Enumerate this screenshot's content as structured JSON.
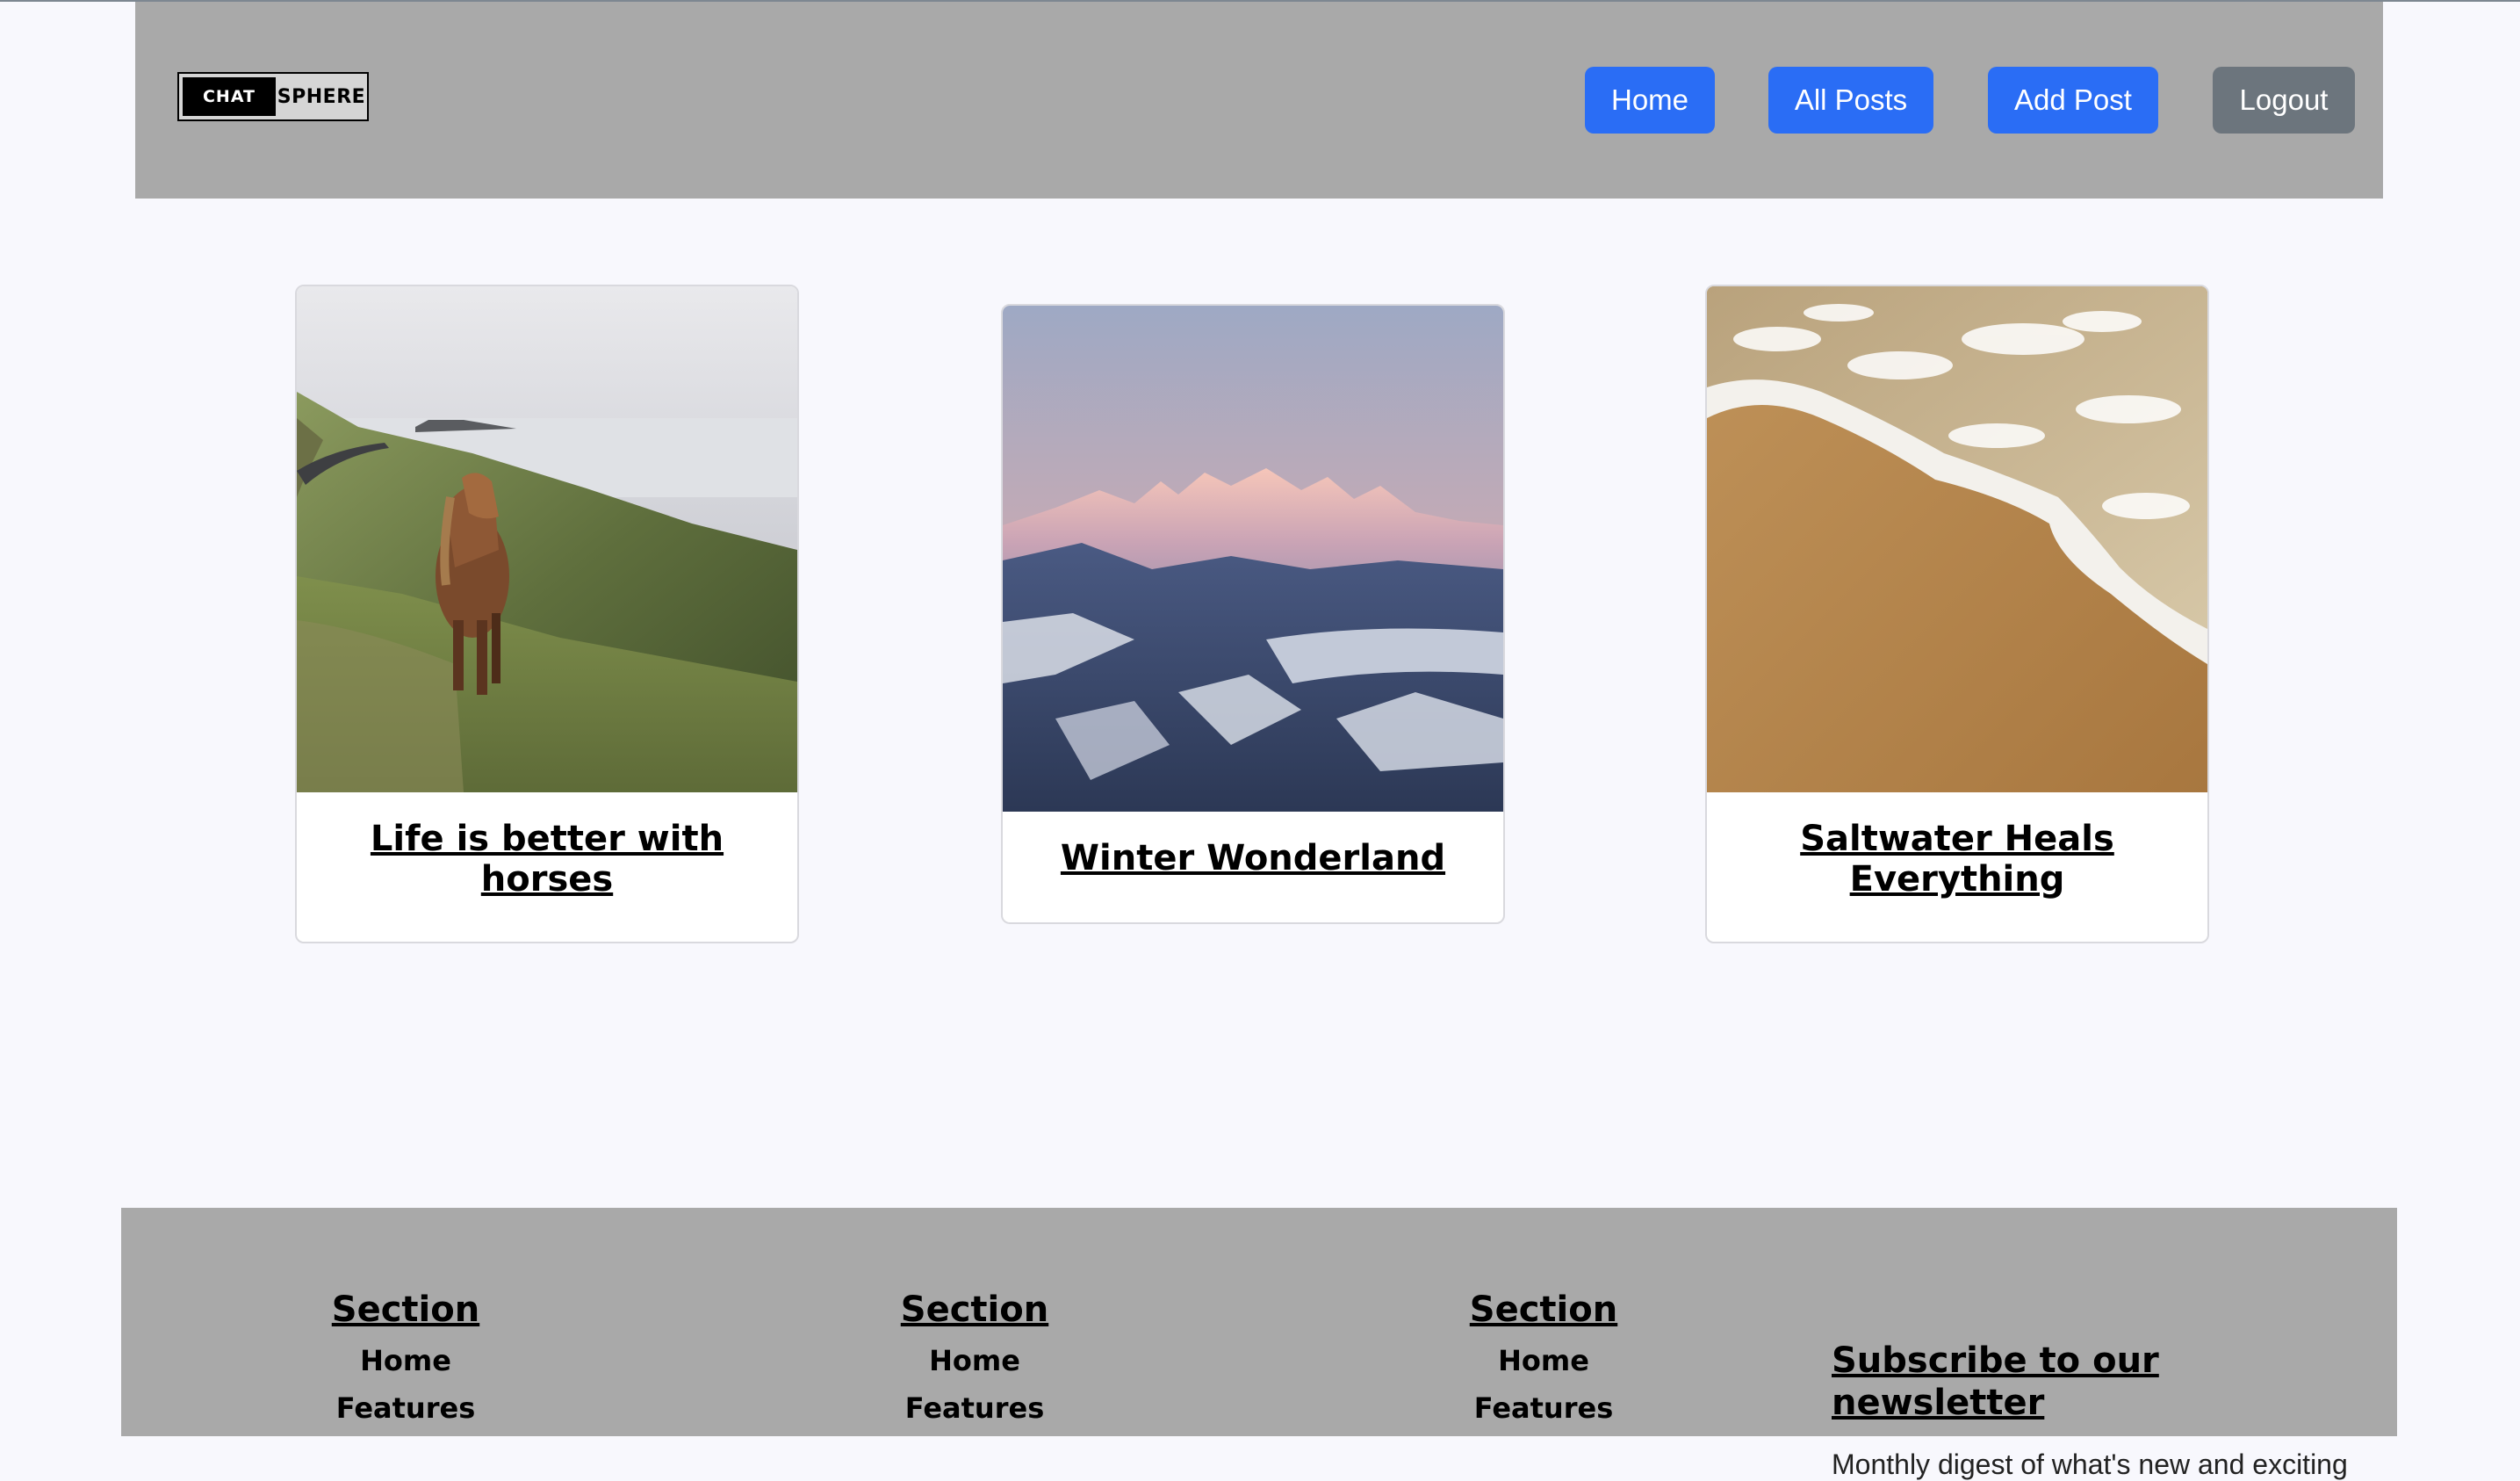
{
  "brand": {
    "logo_left": "CHAT",
    "logo_right": "SPHERE"
  },
  "nav": {
    "home": "Home",
    "all_posts": "All Posts",
    "add_post": "Add Post",
    "logout": "Logout"
  },
  "posts": [
    {
      "title": "Life is better with horses",
      "image": "horse-on-coastal-hillside"
    },
    {
      "title": "Winter Wonderland",
      "image": "snowy-mountains-at-sunset"
    },
    {
      "title": "Saltwater Heals Everything",
      "image": "ocean-foam-on-sand-beach"
    }
  ],
  "footer": {
    "columns": [
      {
        "heading": "Section",
        "links": [
          "Home",
          "Features"
        ]
      },
      {
        "heading": "Section",
        "links": [
          "Home",
          "Features"
        ]
      },
      {
        "heading": "Section",
        "links": [
          "Home",
          "Features"
        ]
      }
    ],
    "newsletter": {
      "title": "Subscribe to our newsletter",
      "text": "Monthly digest of what's new and exciting"
    }
  },
  "colors": {
    "header_bg": "#a9a9a9",
    "primary": "#2a6df5",
    "secondary": "#6c757d",
    "page_bg": "#f8f8fd"
  }
}
